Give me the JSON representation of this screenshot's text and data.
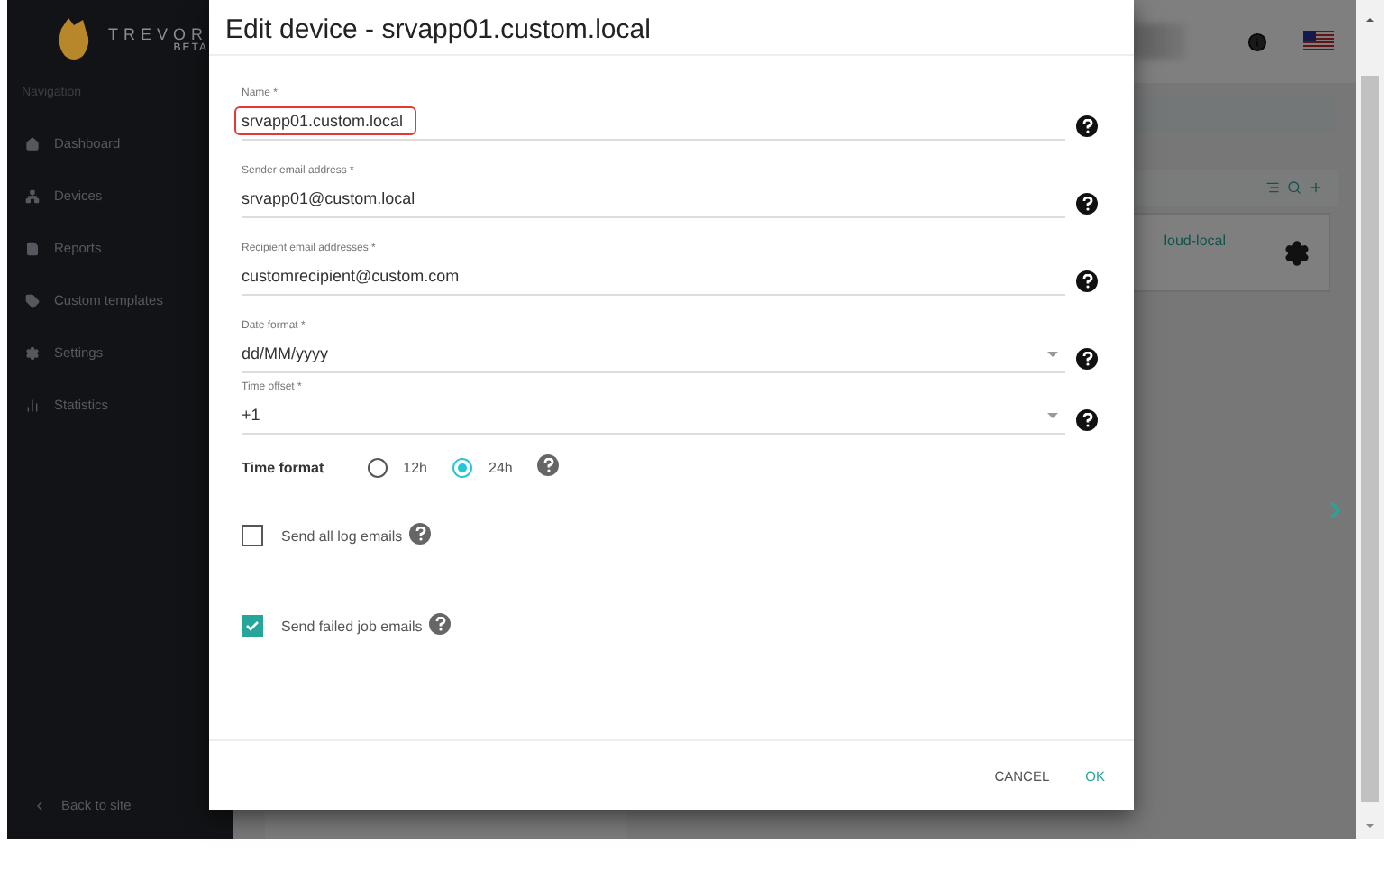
{
  "sidebar": {
    "logo": {
      "name": "TREVOR",
      "tag": "BETA"
    },
    "section": "Navigation",
    "items": [
      {
        "label": "Dashboard"
      },
      {
        "label": "Devices"
      },
      {
        "label": "Reports"
      },
      {
        "label": "Custom templates"
      },
      {
        "label": "Settings"
      },
      {
        "label": "Statistics"
      }
    ],
    "back": "Back to site"
  },
  "background": {
    "card_text": "loud-local"
  },
  "dialog": {
    "title": "Edit device - srvapp01.custom.local",
    "fields": [
      {
        "kind": "text",
        "label": "Name *",
        "value": "srvapp01.custom.local",
        "highlighted": true
      },
      {
        "kind": "text",
        "label": "Sender email address *",
        "value": "srvapp01@custom.local",
        "highlighted": false
      },
      {
        "kind": "text",
        "label": "Recipient email addresses *",
        "value": "customrecipient@custom.com",
        "highlighted": false
      },
      {
        "kind": "select",
        "label": "Date format *",
        "value": "dd/MM/yyyy",
        "highlighted": false
      },
      {
        "kind": "select",
        "label": "Time offset *",
        "value": "+1",
        "highlighted": false
      }
    ],
    "time_format": {
      "label": "Time format",
      "options": [
        {
          "label": "12h",
          "selected": false
        },
        {
          "label": "24h",
          "selected": true
        }
      ]
    },
    "checkboxes": [
      {
        "label": "Send all log emails",
        "checked": false
      },
      {
        "label": "Send failed job emails",
        "checked": true
      }
    ],
    "buttons": [
      {
        "label": "CANCEL",
        "kind": "secondary"
      },
      {
        "label": "OK",
        "kind": "primary"
      }
    ]
  }
}
